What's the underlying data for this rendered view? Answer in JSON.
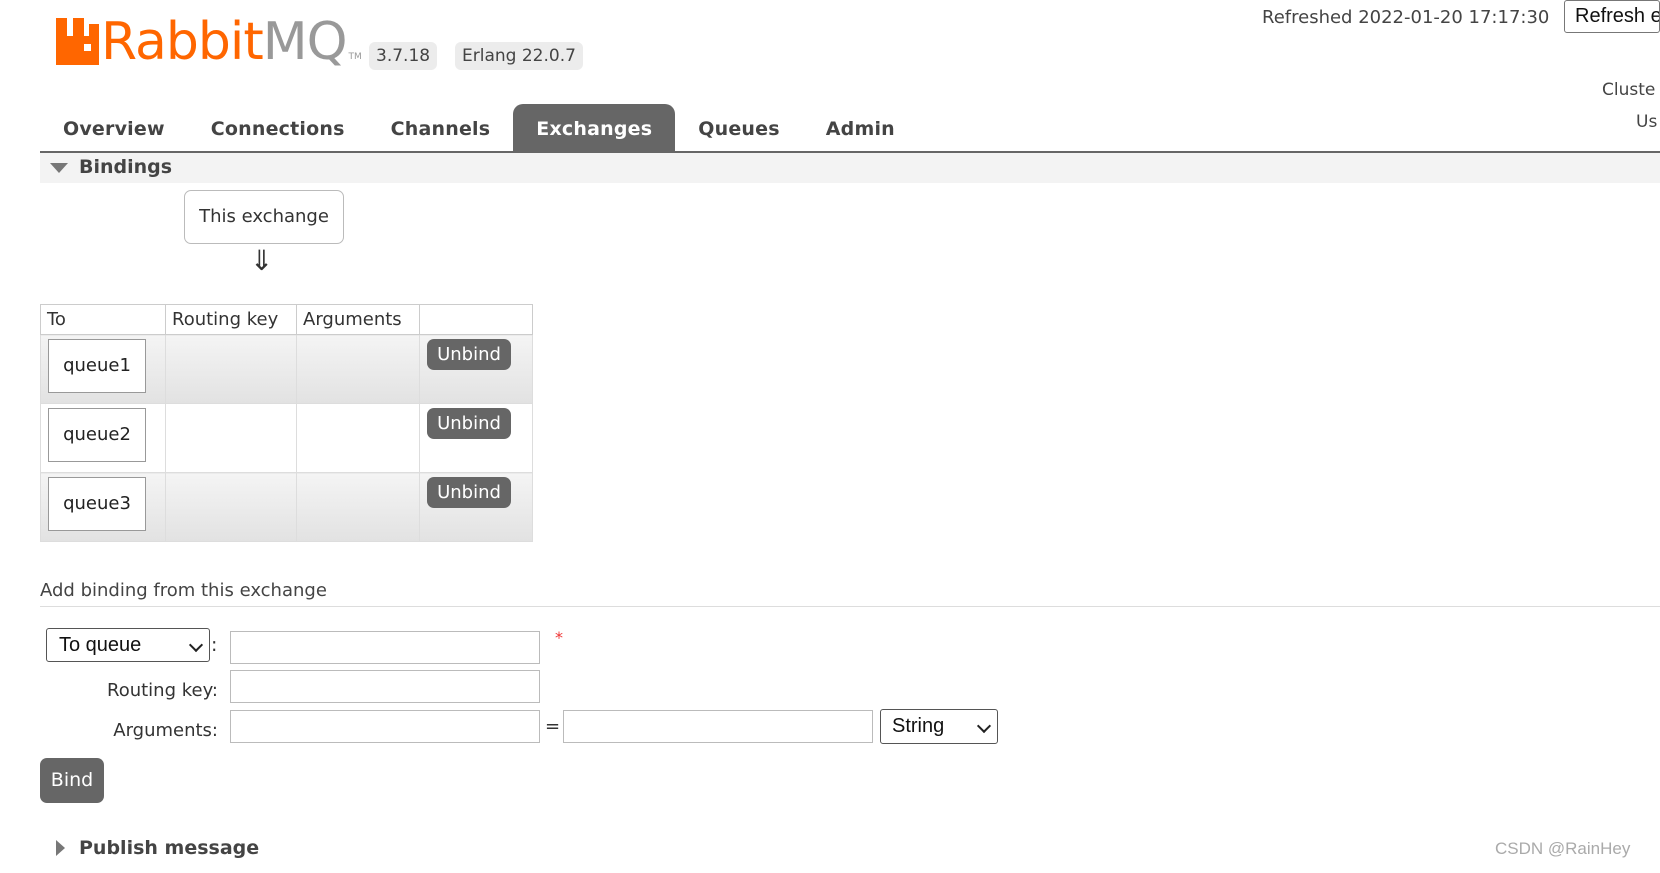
{
  "header": {
    "logo": {
      "brand": "Rabbit",
      "suffix": "MQ",
      "tm": "TM"
    },
    "version": "3.7.18",
    "erlang": "Erlang 22.0.7",
    "refreshed": "Refreshed 2022-01-20 17:17:30",
    "refresh_select_value": "Refresh e",
    "cluster_label": "Cluste",
    "user_label": "Us"
  },
  "tabs": [
    {
      "label": "Overview",
      "active": false
    },
    {
      "label": "Connections",
      "active": false
    },
    {
      "label": "Channels",
      "active": false
    },
    {
      "label": "Exchanges",
      "active": true
    },
    {
      "label": "Queues",
      "active": false
    },
    {
      "label": "Admin",
      "active": false
    }
  ],
  "bindings": {
    "title": "Bindings",
    "source_label": "This exchange",
    "arrow": "⇓",
    "columns": [
      "To",
      "Routing key",
      "Arguments",
      ""
    ],
    "rows": [
      {
        "to": "queue1",
        "routing_key": "",
        "arguments": "",
        "action": "Unbind"
      },
      {
        "to": "queue2",
        "routing_key": "",
        "arguments": "",
        "action": "Unbind"
      },
      {
        "to": "queue3",
        "routing_key": "",
        "arguments": "",
        "action": "Unbind"
      }
    ]
  },
  "add_binding": {
    "title": "Add binding from this exchange",
    "destination_type": "To queue",
    "colon": ":",
    "destination_value": "",
    "required_mark": "*",
    "routing_key_label": "Routing key:",
    "routing_key_value": "",
    "arguments_label": "Arguments:",
    "arg_key_value": "",
    "equals": "=",
    "arg_value": "",
    "arg_type": "String",
    "bind_label": "Bind"
  },
  "publish": {
    "title": "Publish message"
  },
  "watermark": "CSDN @RainHey",
  "colors": {
    "brand": "#ff6600",
    "tab_active": "#666666",
    "button": "#666666",
    "required": "#ee3333"
  }
}
